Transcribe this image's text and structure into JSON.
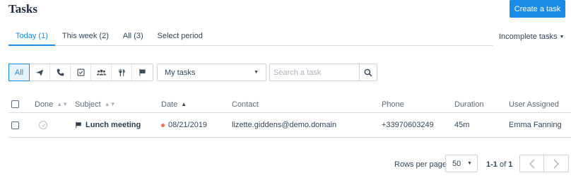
{
  "header": {
    "title": "Tasks",
    "create_button": "Create a task"
  },
  "tabs": [
    {
      "label": "Today (1)",
      "active": true
    },
    {
      "label": "This week (2)",
      "active": false
    },
    {
      "label": "All (3)",
      "active": false
    },
    {
      "label": "Select period",
      "active": false
    }
  ],
  "filter_status": {
    "label": "Incomplete tasks"
  },
  "type_filter": {
    "all_label": "All",
    "icons": [
      "send-icon",
      "phone-icon",
      "todo-checkbox-icon",
      "group-icon",
      "fork-knife-icon",
      "flag-icon"
    ]
  },
  "owner_select": {
    "value": "My tasks"
  },
  "search": {
    "placeholder": "Search a task"
  },
  "table": {
    "columns": {
      "done": "Done",
      "subject": "Subject",
      "date": "Date",
      "contact": "Contact",
      "phone": "Phone",
      "duration": "Duration",
      "user": "User Assigned"
    },
    "rows": [
      {
        "subject": "Lunch meeting",
        "date": "08/21/2019",
        "contact": "lizette.giddens@demo.domain",
        "phone": "+33970603249",
        "duration": "45m",
        "user": "Emma Fanning",
        "type_icon": "flag-icon",
        "date_dot_color": "#f2724f"
      }
    ]
  },
  "pagination": {
    "rows_label": "Rows per page",
    "rows_value": "50",
    "range_prefix": "1-1",
    "range_of": "of",
    "range_total": "1"
  },
  "colors": {
    "accent": "#1a8ce8",
    "text": "#33475b",
    "border": "#cdd3da"
  }
}
